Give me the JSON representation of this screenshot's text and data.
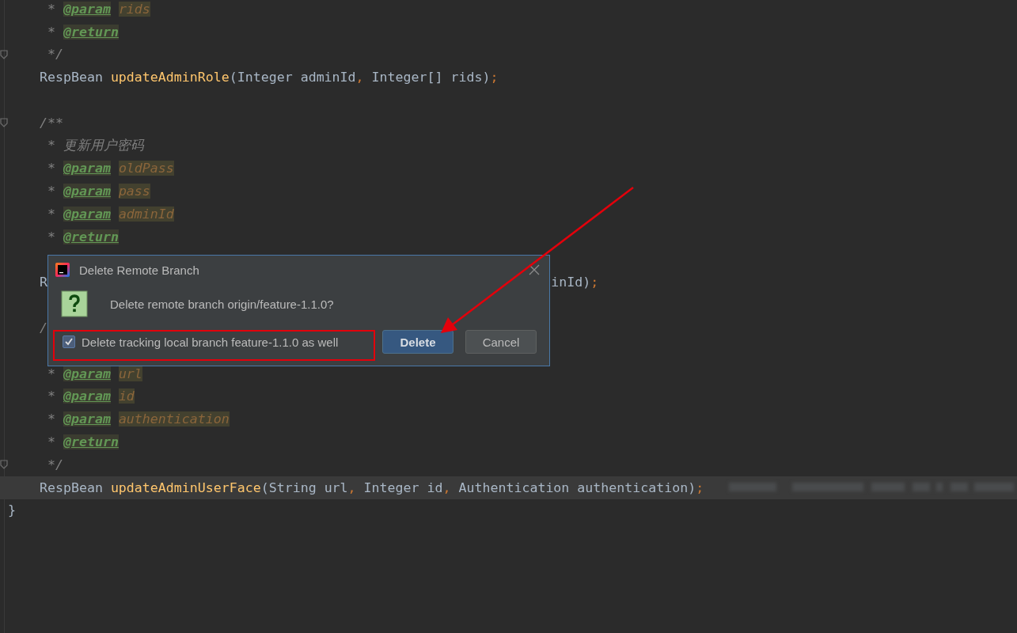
{
  "editor": {
    "body": [
      {
        "fold": false,
        "current": false,
        "tokens": [
          {
            "kind": "comment",
            "text": " * "
          },
          {
            "kind": "tag",
            "text": "@param"
          },
          {
            "kind": "param",
            "text": "rids"
          }
        ]
      },
      {
        "fold": false,
        "current": false,
        "tokens": [
          {
            "kind": "comment",
            "text": " * "
          },
          {
            "kind": "tag",
            "text": "@return"
          }
        ]
      },
      {
        "fold": true,
        "current": false,
        "tokens": [
          {
            "kind": "comment",
            "text": " */"
          }
        ]
      },
      {
        "fold": false,
        "current": false,
        "tokens": [
          {
            "kind": "plain",
            "text": "RespBean "
          },
          {
            "kind": "method",
            "text": "updateAdminRole"
          },
          {
            "kind": "plain",
            "text": "(Integer adminId"
          },
          {
            "kind": "punct",
            "text": ", "
          },
          {
            "kind": "plain",
            "text": "Integer[] rids)"
          },
          {
            "kind": "punct",
            "text": ";"
          }
        ]
      },
      {
        "fold": false,
        "current": false
      },
      {
        "fold": true,
        "current": false,
        "tokens": [
          {
            "kind": "comment",
            "text": "/**"
          }
        ]
      },
      {
        "fold": false,
        "current": false,
        "tokens": [
          {
            "kind": "comment",
            "text": " * 更新用户密码"
          }
        ]
      },
      {
        "fold": false,
        "current": false,
        "tokens": [
          {
            "kind": "comment",
            "text": " * "
          },
          {
            "kind": "tag",
            "text": "@param"
          },
          {
            "kind": "param",
            "text": "oldPass"
          }
        ]
      },
      {
        "fold": false,
        "current": false,
        "tokens": [
          {
            "kind": "comment",
            "text": " * "
          },
          {
            "kind": "tag",
            "text": "@param"
          },
          {
            "kind": "param",
            "text": "pass"
          }
        ]
      },
      {
        "fold": false,
        "current": false,
        "tokens": [
          {
            "kind": "comment",
            "text": " * "
          },
          {
            "kind": "tag",
            "text": "@param"
          },
          {
            "kind": "param",
            "text": "adminId"
          }
        ]
      },
      {
        "fold": false,
        "current": false,
        "tokens": [
          {
            "kind": "comment",
            "text": " * "
          },
          {
            "kind": "tag",
            "text": "@return"
          }
        ]
      },
      {
        "fold": false,
        "current": false
      },
      {
        "fold": false,
        "current": false,
        "tokens": [
          {
            "kind": "plain",
            "text": "R"
          }
        ],
        "right_tokens": [
          {
            "kind": "plain",
            "text": "inId)"
          },
          {
            "kind": "punct",
            "text": ";"
          }
        ]
      },
      {
        "fold": false,
        "current": false
      },
      {
        "fold": false,
        "current": false,
        "tokens": [
          {
            "kind": "comment",
            "text": "/"
          }
        ]
      },
      {
        "fold": false,
        "current": false
      },
      {
        "fold": false,
        "current": false,
        "tokens": [
          {
            "kind": "comment",
            "text": " * "
          },
          {
            "kind": "tag",
            "text": "@param"
          },
          {
            "kind": "param",
            "text": "url"
          }
        ]
      },
      {
        "fold": false,
        "current": false,
        "tokens": [
          {
            "kind": "comment",
            "text": " * "
          },
          {
            "kind": "tag",
            "text": "@param"
          },
          {
            "kind": "param",
            "text": "id"
          }
        ]
      },
      {
        "fold": false,
        "current": false,
        "tokens": [
          {
            "kind": "comment",
            "text": " * "
          },
          {
            "kind": "tag",
            "text": "@param"
          },
          {
            "kind": "param",
            "text": "authentication"
          }
        ]
      },
      {
        "fold": false,
        "current": false,
        "tokens": [
          {
            "kind": "comment",
            "text": " * "
          },
          {
            "kind": "tag",
            "text": "@return"
          }
        ]
      },
      {
        "fold": true,
        "current": false,
        "tokens": [
          {
            "kind": "comment",
            "text": " */"
          }
        ]
      },
      {
        "fold": false,
        "current": true,
        "blurred": true,
        "tokens": [
          {
            "kind": "plain",
            "text": "RespBean "
          },
          {
            "kind": "method",
            "text": "updateAdminUserFace"
          },
          {
            "kind": "plain",
            "text": "(String url"
          },
          {
            "kind": "punct",
            "text": ", "
          },
          {
            "kind": "plain",
            "text": "Integer id"
          },
          {
            "kind": "punct",
            "text": ", "
          },
          {
            "kind": "plain",
            "text": "Authentication authentication)"
          },
          {
            "kind": "punct",
            "text": ";"
          }
        ]
      }
    ],
    "closing": [
      {
        "fold": false,
        "current": false,
        "tokens": [
          {
            "kind": "plain",
            "text": "}"
          }
        ]
      }
    ]
  },
  "dialog": {
    "title": "Delete Remote Branch",
    "message": "Delete remote branch origin/feature-1.1.0?",
    "checkbox": {
      "label": "Delete tracking local branch feature-1.1.0 as well",
      "checked": true
    },
    "buttons": [
      {
        "label": "Delete",
        "default": true
      },
      {
        "label": "Cancel",
        "default": false
      }
    ]
  }
}
